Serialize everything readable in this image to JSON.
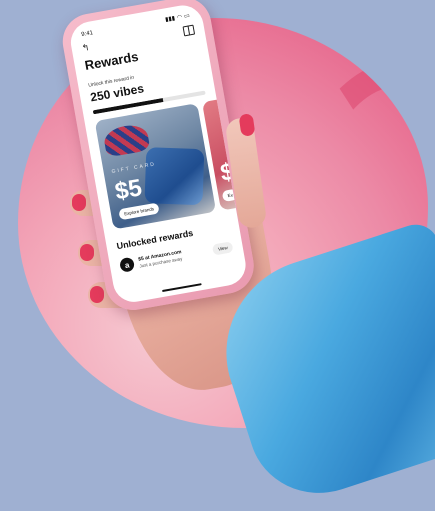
{
  "status": {
    "time": "9:41",
    "signal": "▮▮▮",
    "wifi": "◠",
    "battery": "▭"
  },
  "header": {
    "back_icon": "back-arrow-icon",
    "gift_icon": "gift-icon",
    "title": "Rewards"
  },
  "progress": {
    "label": "Unlock this reward in",
    "value": "250 vibes",
    "fraction": 0.62
  },
  "cards": [
    {
      "eyebrow": "GIFT CARD",
      "amount": "$5",
      "button": "Explore brands"
    },
    {
      "eyebrow": "",
      "amount": "$",
      "button": "Ex"
    }
  ],
  "unlocked": {
    "title": "Unlocked rewards",
    "items": [
      {
        "logo": "a",
        "name": "$5 at Amazon.com",
        "sub": "Just a purchase away",
        "button": "View"
      }
    ]
  },
  "colors": {
    "background": "#9fb0d2",
    "blob": "#ec8aa6",
    "nail": "#e43b5c",
    "sleeve": "#4aa9e0",
    "phone_case": "#f1a9bd"
  }
}
